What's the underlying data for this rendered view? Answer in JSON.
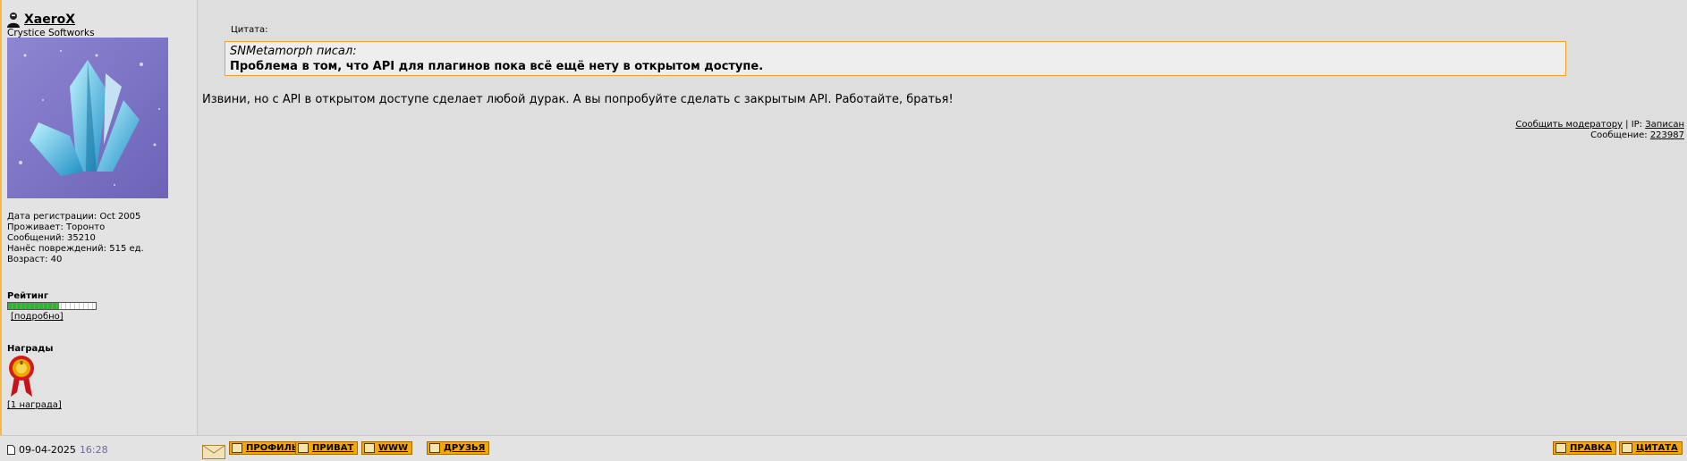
{
  "user": {
    "name": "XaeroX",
    "org": "Crystice Softworks",
    "stats": [
      "Дата регистрации: Oct 2005",
      "Проживает: Торонто",
      "Сообщений: 35210",
      "Нанёс повреждений: 515 ед.",
      "Возраст: 40"
    ],
    "rating_label": "Рейтинг",
    "rating_fraction": 0.58,
    "rating_details": "[подробно]",
    "awards_label": "Награды",
    "awards_link": "[1 награда]"
  },
  "post": {
    "quote_header": "Цитата:",
    "quote_author": "SNMetamorph писал:",
    "quote_text": "Проблема в том, что API для плагинов пока всё ещё нету в открытом доступе.",
    "text": "Извини, но с API в открытом доступе сделает любой дурак. А вы попробуйте сделать с закрытым API. Работайте, братья!",
    "report_link": "Сообщить модератору",
    "ip_label": "| IP:",
    "ip_value": "Записан",
    "msg_label": "Сообщение:",
    "msg_id": "223987"
  },
  "footer": {
    "date": "09-04-2025",
    "time": "16:28",
    "buttons": {
      "profile": "ПРОФИЛЬ",
      "private": "ПРИВАТ",
      "www": "WWW",
      "friends": "ДРУЗЬЯ",
      "edit": "ПРАВКА",
      "quote": "ЦИТАТА"
    }
  },
  "colors": {
    "accent": "#f5a800",
    "quote_border": "#f0a22e",
    "background": "#dedede",
    "rating_fill": "#2db52d"
  }
}
